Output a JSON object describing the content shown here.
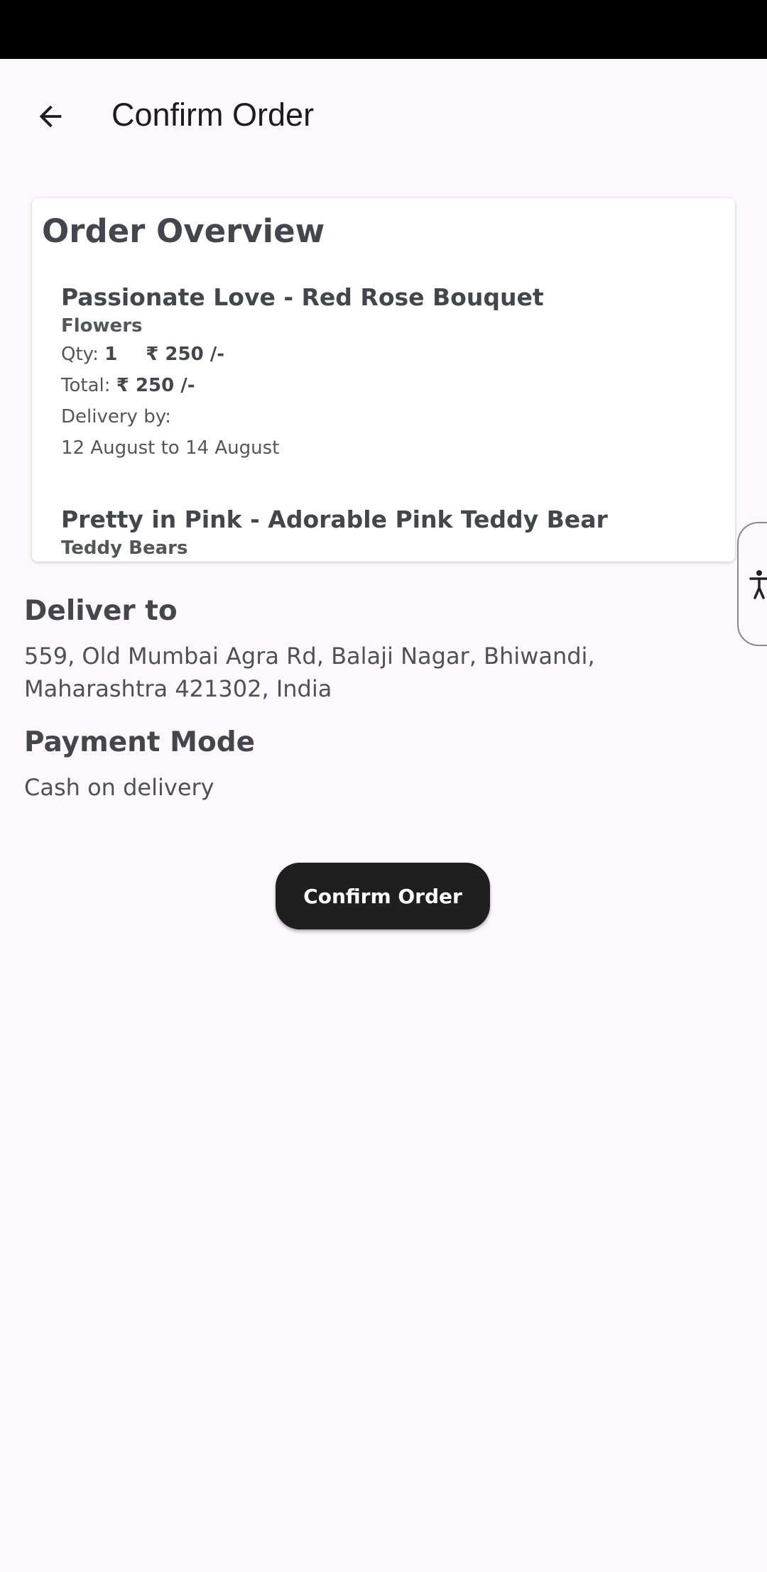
{
  "app_bar": {
    "title": "Confirm Order",
    "back_icon": "arrow-left-icon"
  },
  "order_overview": {
    "title": "Order Overview",
    "items": [
      {
        "name": "Passionate Love - Red Rose Bouquet",
        "category": "Flowers",
        "qty_label": "Qty:",
        "qty": "1",
        "price": "₹ 250 /-",
        "total_label": "Total:",
        "total": "₹ 250 /-",
        "delivery_label": "Delivery by:",
        "delivery_dates": "12 August to 14 August"
      },
      {
        "name": "Pretty in Pink - Adorable Pink Teddy Bear",
        "category": "Teddy Bears"
      }
    ]
  },
  "deliver_to": {
    "heading": "Deliver to",
    "address": "559, Old Mumbai Agra Rd, Balaji Nagar, Bhiwandi, Maharashtra 421302, India"
  },
  "payment": {
    "heading": "Payment Mode",
    "mode": "Cash on delivery"
  },
  "confirm_button": {
    "label": "Confirm Order"
  },
  "accessibility_tab": {
    "icon": "accessibility-person-icon"
  }
}
